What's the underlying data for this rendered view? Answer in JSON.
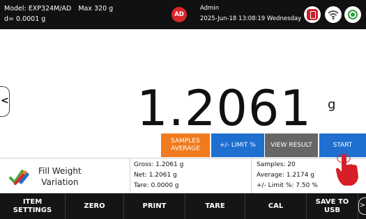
{
  "status_bar": {
    "model": "Model: EXP324M/AD",
    "max_capacity": "Max 320 g",
    "readability": "d= 0.0001 g",
    "user_initials": "AD",
    "user_name": "Admin",
    "datetime": "2025-Jun-18 13:08:19 Wednesday",
    "icons": [
      "usb-icon",
      "wifi-icon",
      "record-icon"
    ]
  },
  "display": {
    "weight_value": "1.2061",
    "unit": "g",
    "nav_arrow": "<"
  },
  "function_buttons": {
    "samples_average": "SAMPLES AVERAGE",
    "limit_percent": "+/- LIMIT %",
    "view_result": "VIEW RESULT",
    "start": "START"
  },
  "application": {
    "name_line1": "Fill Weight",
    "name_line2": "Variation"
  },
  "readings": {
    "gross": "Gross: 1.2061 g",
    "net": "Net: 1.2061 g",
    "tare": "Tare: 0.0000 g",
    "samples": "Samples: 20",
    "average": "Average: 1.2174 g",
    "limit": "+/- Limit %: 7.50 %"
  },
  "bottom_bar": {
    "item_settings_line1": "ITEM",
    "item_settings_line2": "SETTINGS",
    "zero": "ZERO",
    "print": "PRINT",
    "tare": "TARE",
    "cal": "CAL",
    "save_to_usb_line1": "SAVE TO",
    "save_to_usb_line2": "USB",
    "next_arrow": ">"
  },
  "colors": {
    "orange_button": "#f07b1f",
    "blue_button": "#1e6fd0",
    "grey_button": "#666666",
    "user_badge": "#d9262c",
    "hand_red": "#d61f26"
  }
}
